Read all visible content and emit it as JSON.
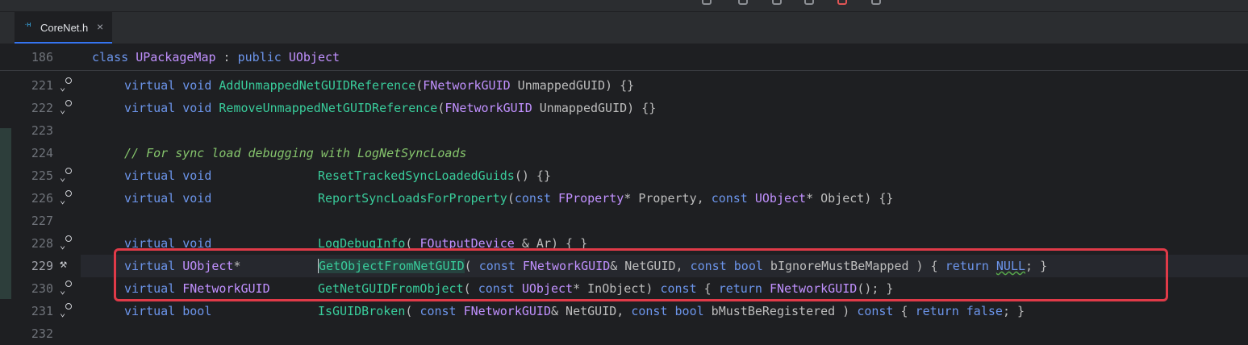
{
  "tab": {
    "icon_text": "·H",
    "filename": "CoreNet.h",
    "close": "×"
  },
  "sticky": {
    "num": "186",
    "kw1": "class",
    "cls": "UPackageMap",
    "colon": " : ",
    "kw2": "public",
    "base": "UObject"
  },
  "lines": {
    "l221": {
      "num": "221",
      "a": "virtual",
      "b": "void",
      "fn": "AddUnmappedNetGUIDReference",
      "p1": "(",
      "t": "FNetworkGUID",
      "p2": " UnmappedGUID) {}"
    },
    "l222": {
      "num": "222",
      "a": "virtual",
      "b": "void",
      "fn": "RemoveUnmappedNetGUIDReference",
      "p1": "(",
      "t": "FNetworkGUID",
      "p2": " UnmappedGUID) {}"
    },
    "l223": {
      "num": "223"
    },
    "l224": {
      "num": "224",
      "comment": "// For sync load debugging with LogNetSyncLoads"
    },
    "l225": {
      "num": "225",
      "a": "virtual",
      "b": "void",
      "fn": "ResetTrackedSyncLoadedGuids",
      "rest": "() {}"
    },
    "l226": {
      "num": "226",
      "a": "virtual",
      "b": "void",
      "fn": "ReportSyncLoadsForProperty",
      "p1": "(",
      "c1": "const",
      "t1": "FProperty",
      "p2": "* Property, ",
      "c2": "const",
      "t2": "UObject",
      "p3": "* Object) {}"
    },
    "l227": {
      "num": "227"
    },
    "l228": {
      "num": "228",
      "a": "virtual",
      "b": "void",
      "fn": "LogDebugInfo",
      "p1": "( ",
      "t": "FOutputDevice",
      "p2": " & Ar) { }"
    },
    "l229": {
      "num": "229",
      "a": "virtual",
      "t0": "UObject",
      "star": "*",
      "fn": "GetObjectFromNetGUID",
      "p1": "( ",
      "c1": "const",
      "t1": "FNetworkGUID",
      "p2": "& NetGUID, ",
      "c2": "const",
      "b2": "bool",
      "p3": " bIgnoreMustBeMapped ) { ",
      "r": "return",
      "n": "NULL",
      "p4": "; }"
    },
    "l230": {
      "num": "230",
      "a": "virtual",
      "t0": "FNetworkGUID",
      "fn": "GetNetGUIDFromObject",
      "p1": "( ",
      "c1": "const",
      "t1": "UObject",
      "p2": "* InObject) ",
      "c2": "const",
      "p3": " { ",
      "r": "return",
      "t2": "FNetworkGUID",
      "p4": "(); }"
    },
    "l231": {
      "num": "231",
      "a": "virtual",
      "b": "bool",
      "fn": "IsGUIDBroken",
      "p1": "( ",
      "c1": "const",
      "t1": "FNetworkGUID",
      "p2": "& NetGUID, ",
      "c2": "const",
      "b2": "bool",
      "p3": " bMustBeRegistered ) ",
      "c3": "const",
      "p4": " { ",
      "r": "return",
      "f": "false",
      "p5": "; }"
    },
    "l232": {
      "num": "232"
    }
  }
}
